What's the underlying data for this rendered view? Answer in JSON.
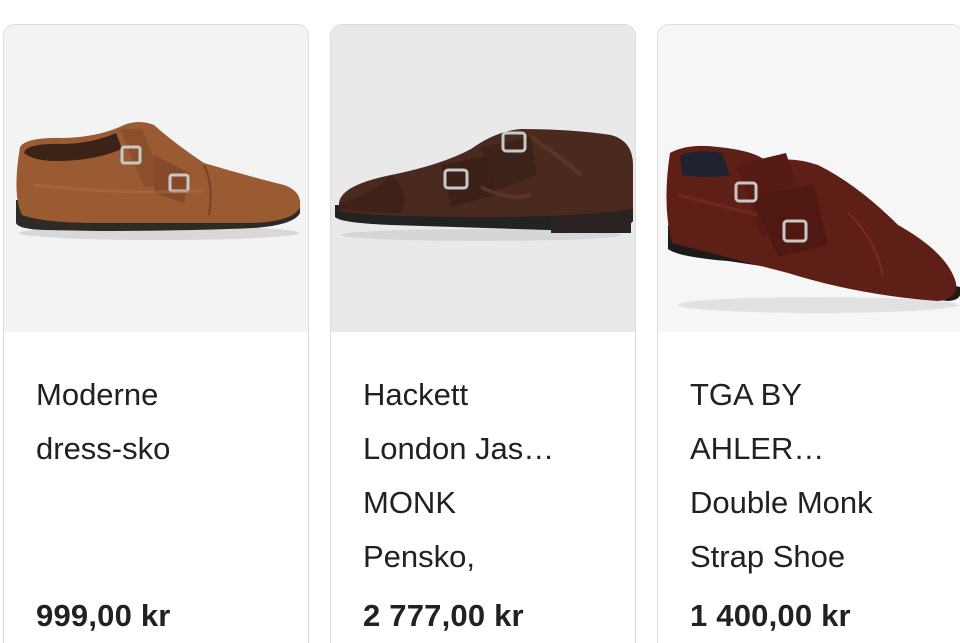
{
  "products": [
    {
      "title": "Moderne\ndress-sko",
      "price": "999,00 kr",
      "image_icon": "brown-double-monk-shoe-image"
    },
    {
      "title": "Hackett\nLondon Jas…\nMONK\nPensko,",
      "price": "2 777,00 kr",
      "image_icon": "dark-brown-double-monk-shoe-image"
    },
    {
      "title": "TGA BY\nAHLER…\nDouble Monk\nStrap Shoe",
      "price": "1 400,00 kr",
      "image_icon": "burgundy-double-monk-shoe-image"
    }
  ],
  "colors": {
    "text": "#202124",
    "card_border": "#dcdcdc",
    "shoe_1": "#9a5a32",
    "shoe_2": "#4a2a1e",
    "shoe_3": "#5e1f17"
  }
}
